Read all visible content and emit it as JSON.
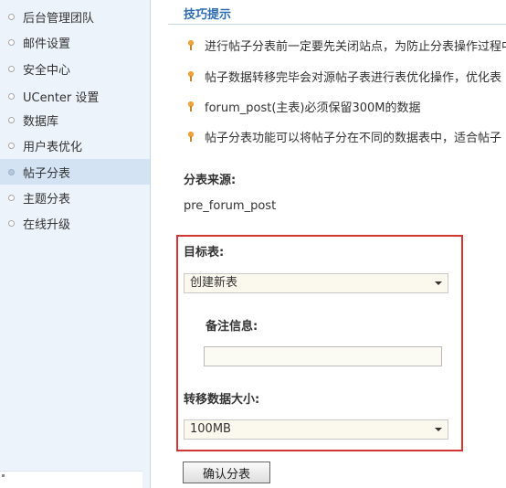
{
  "sidebar": {
    "items": [
      {
        "label": "后台管理团队",
        "active": false
      },
      {
        "label": "邮件设置",
        "active": false
      },
      {
        "label": "安全中心",
        "active": false
      },
      {
        "label": "UCenter 设置",
        "active": false
      },
      {
        "label": "数据库",
        "active": false
      },
      {
        "label": "用户表优化",
        "active": false
      },
      {
        "label": "帖子分表",
        "active": true
      },
      {
        "label": "主题分表",
        "active": false
      },
      {
        "label": "在线升级",
        "active": false
      }
    ]
  },
  "tips": {
    "title": "技巧提示",
    "items": [
      "进行帖子分表前一定要先关闭站点，为防止分表操作过程中",
      "帖子数据转移完毕会对源帖子表进行表优化操作，优化表",
      "forum_post(主表)必须保留300M的数据",
      "帖子分表功能可以将帖子分在不同的数据表中，适合帖子"
    ],
    "icon": "pin-icon"
  },
  "form": {
    "source_label": "分表来源:",
    "source_value": "pre_forum_post",
    "target_label": "目标表:",
    "target_value": "创建新表",
    "note_label": "备注信息:",
    "note_value": "",
    "size_label": "转移数据大小:",
    "size_value": "100MB",
    "submit_label": "确认分表"
  },
  "colors": {
    "highlight_border": "#d63535",
    "tips_title": "#2b6cb0",
    "sidebar_bg": "#edf3fa"
  }
}
